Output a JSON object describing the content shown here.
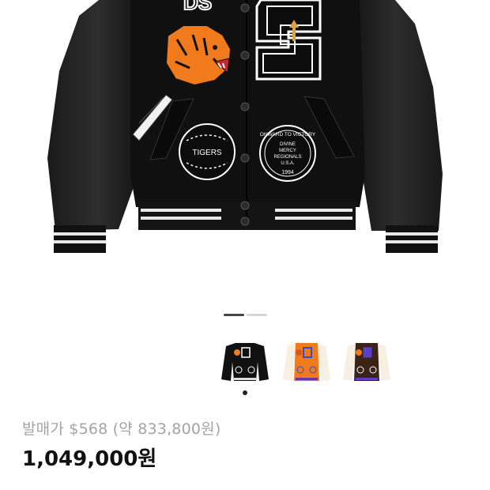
{
  "product": {
    "release_label": "발매가 $568 (약 833,800원)",
    "current_price": "1,049,000원"
  },
  "gallery": {
    "image_count": 2,
    "current_index": 1
  },
  "jacket": {
    "patch_tigers": "TIGERS",
    "patch_circle_ring": "ONWARD TO VICTORY",
    "patch_circle_center_1": "DIVINE",
    "patch_circle_center_2": "MERCY",
    "patch_circle_center_3": "REGIONALS",
    "patch_circle_center_4": "U.S.A.",
    "patch_circle_year": "1994"
  },
  "colors": {
    "accent": "#111111",
    "muted": "#a3a3a3",
    "orange": "#f07a1c",
    "black": "#0d0d0d",
    "brown": "#3b2318"
  },
  "color_options": [
    {
      "name": "black-jacket-thumb"
    },
    {
      "name": "orange-jacket-thumb"
    },
    {
      "name": "brown-jacket-thumb"
    }
  ]
}
